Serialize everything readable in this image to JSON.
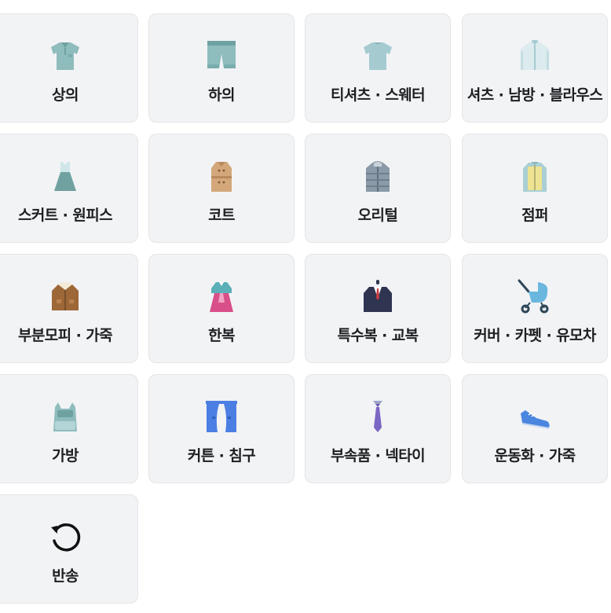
{
  "categories": [
    {
      "label": "상의",
      "icon": "polo-shirt-icon"
    },
    {
      "label": "하의",
      "icon": "shorts-icon"
    },
    {
      "label": "티셔츠 · 스웨터",
      "icon": "t-shirt-icon"
    },
    {
      "label": "셔츠 · 남방 · 블라우스",
      "icon": "jacket-shirt-icon"
    },
    {
      "label": "스커트 · 원피스",
      "icon": "dress-icon"
    },
    {
      "label": "코트",
      "icon": "trench-coat-icon"
    },
    {
      "label": "오리털",
      "icon": "padded-jacket-icon"
    },
    {
      "label": "점퍼",
      "icon": "vest-jumper-icon"
    },
    {
      "label": "부분모피 · 가죽",
      "icon": "fur-jacket-icon"
    },
    {
      "label": "한복",
      "icon": "hanbok-icon"
    },
    {
      "label": "특수복 · 교복",
      "icon": "suit-uniform-icon"
    },
    {
      "label": "커버 · 카펫 · 유모차",
      "icon": "stroller-icon"
    },
    {
      "label": "가방",
      "icon": "backpack-icon"
    },
    {
      "label": "커튼 · 침구",
      "icon": "curtain-icon"
    },
    {
      "label": "부속품 · 넥타이",
      "icon": "necktie-icon"
    },
    {
      "label": "운동화 · 가죽",
      "icon": "sneaker-icon"
    },
    {
      "label": "반송",
      "icon": "return-arrow-icon"
    }
  ]
}
